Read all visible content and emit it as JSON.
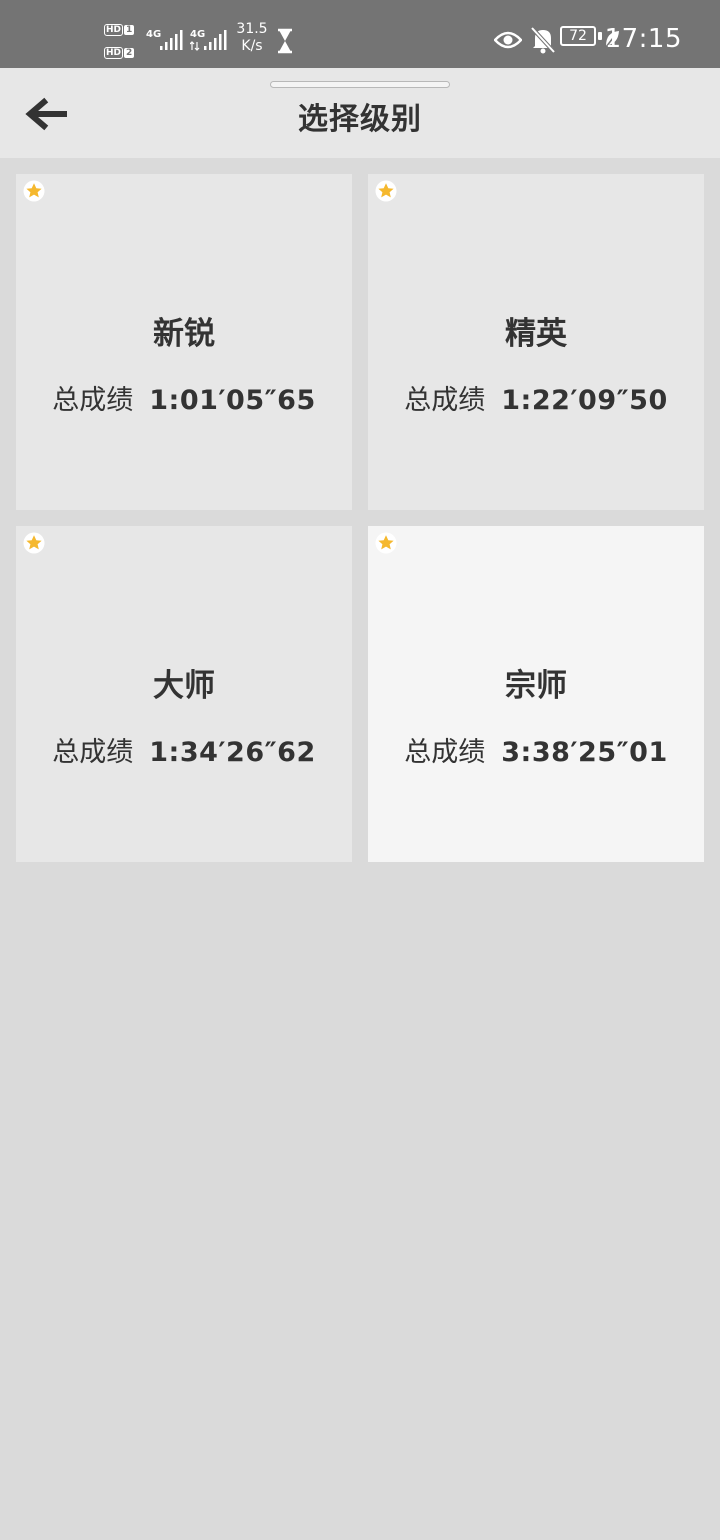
{
  "status_bar": {
    "sim1": "1",
    "sim2": "2",
    "hd": "HD",
    "network1": "4G",
    "network2": "4G",
    "net_speed_value": "31.5",
    "net_speed_unit": "K/s",
    "battery": "72",
    "time": "17:15"
  },
  "header": {
    "title": "选择级别"
  },
  "levels": [
    {
      "name": "新锐",
      "score_label": "总成绩",
      "score": "1:01′05″65",
      "starred": true,
      "selected": false
    },
    {
      "name": "精英",
      "score_label": "总成绩",
      "score": "1:22′09″50",
      "starred": true,
      "selected": false
    },
    {
      "name": "大师",
      "score_label": "总成绩",
      "score": "1:34′26″62",
      "starred": true,
      "selected": false
    },
    {
      "name": "宗师",
      "score_label": "总成绩",
      "score": "3:38′25″01",
      "starred": true,
      "selected": true
    }
  ],
  "colors": {
    "star": "#f5b82e",
    "card": "#e7e7e7",
    "card_selected": "#f5f5f5",
    "background": "#dadada",
    "status_bar": "#747474"
  }
}
